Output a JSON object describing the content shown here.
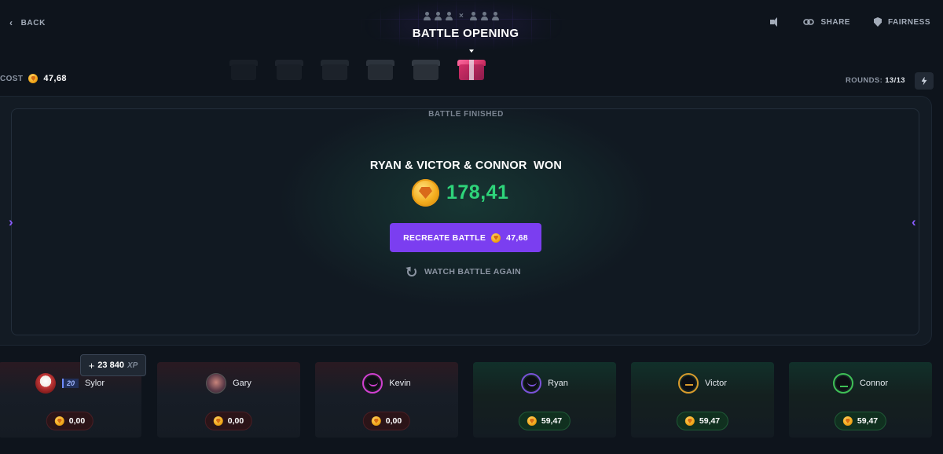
{
  "header": {
    "back_label": "BACK",
    "title": "BATTLE OPENING",
    "share_label": "SHARE",
    "fairness_label": "FAIRNESS",
    "teams_separator": "×"
  },
  "strip": {
    "cost_label": "COST",
    "cost_value": "47,68",
    "rounds_label": "ROUNDS:",
    "rounds_value": "13/13"
  },
  "arena": {
    "status": "BATTLE FINISHED",
    "winners_text": "RYAN & VICTOR & CONNOR  WON",
    "prize_value": "178,41",
    "recreate_label": "RECREATE BATTLE",
    "recreate_cost": "47,68",
    "watch_again_label": "WATCH BATTLE AGAIN"
  },
  "xp_popup": {
    "plus": "+",
    "amount": "23 840",
    "unit": "XP"
  },
  "players": [
    {
      "name": "Sylor",
      "level": "20",
      "amount": "0,00",
      "result": "lose"
    },
    {
      "name": "Gary",
      "amount": "0,00",
      "result": "lose"
    },
    {
      "name": "Kevin",
      "amount": "0,00",
      "result": "lose"
    },
    {
      "name": "Ryan",
      "amount": "59,47",
      "result": "win"
    },
    {
      "name": "Victor",
      "amount": "59,47",
      "result": "win"
    },
    {
      "name": "Connor",
      "amount": "59,47",
      "result": "win"
    }
  ],
  "colors": {
    "accent": "#7b3ef0",
    "prize_green": "#2ed47a",
    "background": "#0e141c"
  }
}
